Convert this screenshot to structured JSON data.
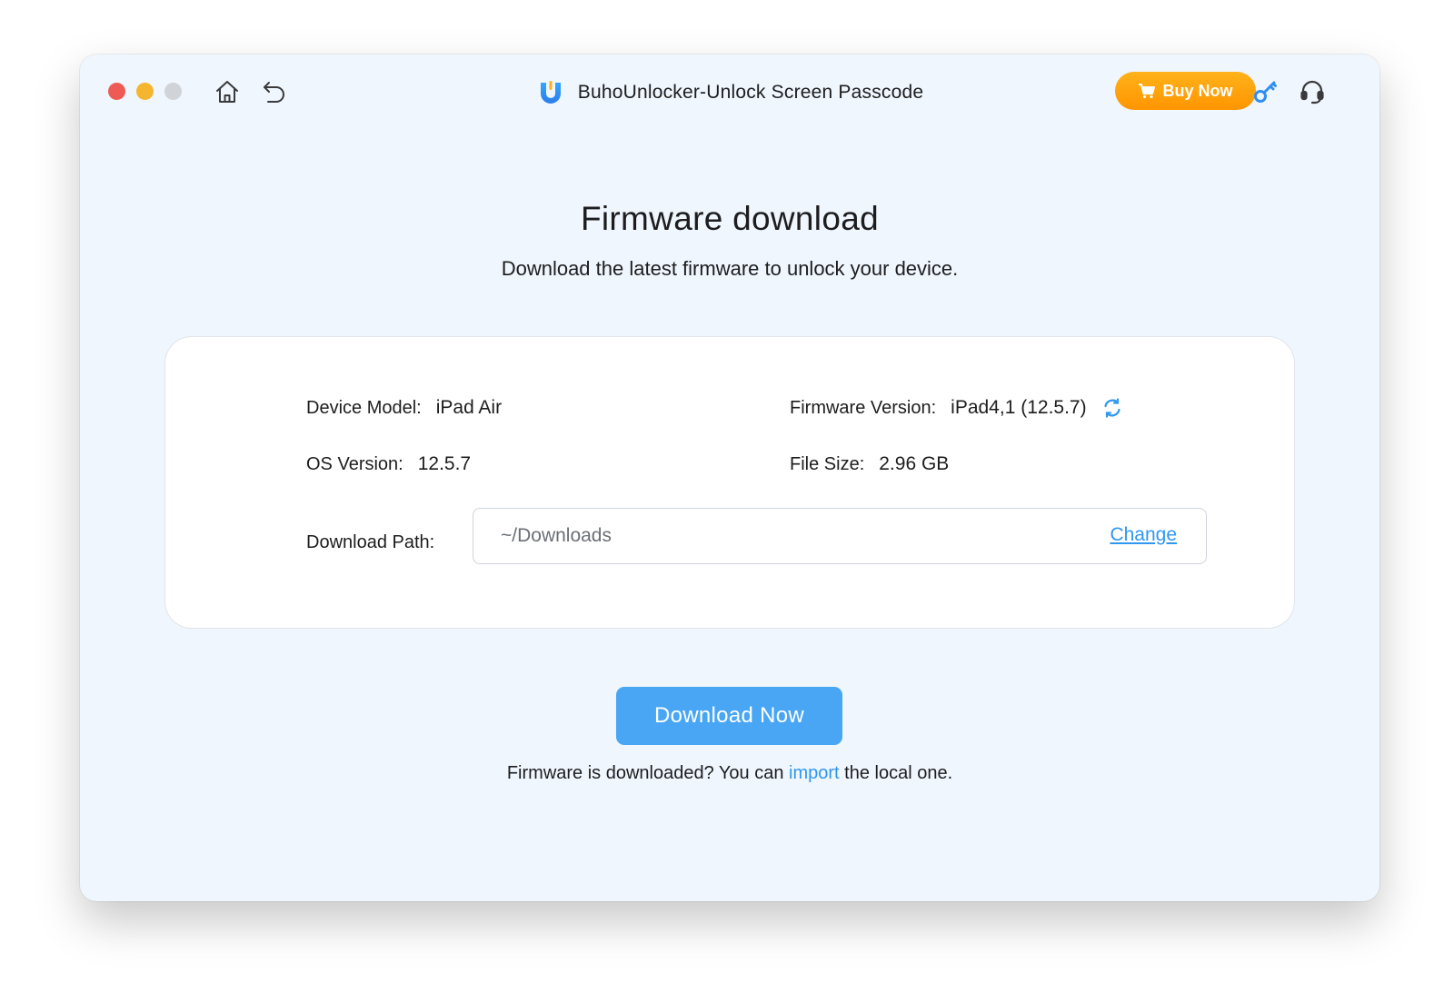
{
  "window": {
    "title": "BuhoUnlocker-Unlock Screen Passcode",
    "buy_label": "Buy Now"
  },
  "icons": {
    "close": "close-button",
    "minimize": "minimize-button",
    "maximize": "maximize-button",
    "home": "home-icon",
    "back": "back-icon",
    "logo": "buho-logo-icon",
    "cart": "cart-icon",
    "key": "key-icon",
    "support": "headset-icon",
    "refresh": "refresh-icon"
  },
  "colors": {
    "accent": "#48a6f5",
    "link": "#2f97f0",
    "buy_orange": "#ff9f0a",
    "background": "#eff6fd"
  },
  "main": {
    "title": "Firmware download",
    "subtitle": "Download the latest firmware to unlock your device."
  },
  "info": {
    "device_model_label": "Device Model:",
    "device_model_value": "iPad Air",
    "firmware_version_label": "Firmware Version:",
    "firmware_version_value": "iPad4,1 (12.5.7)",
    "os_version_label": "OS Version:",
    "os_version_value": "12.5.7",
    "file_size_label": "File Size:",
    "file_size_value": "2.96 GB",
    "download_path_label": "Download Path:",
    "download_path_value": "~/Downloads",
    "change_label": "Change"
  },
  "actions": {
    "download_label": "Download Now",
    "hint_prefix": "Firmware is downloaded? You can ",
    "hint_link": "import",
    "hint_suffix": " the local one."
  }
}
